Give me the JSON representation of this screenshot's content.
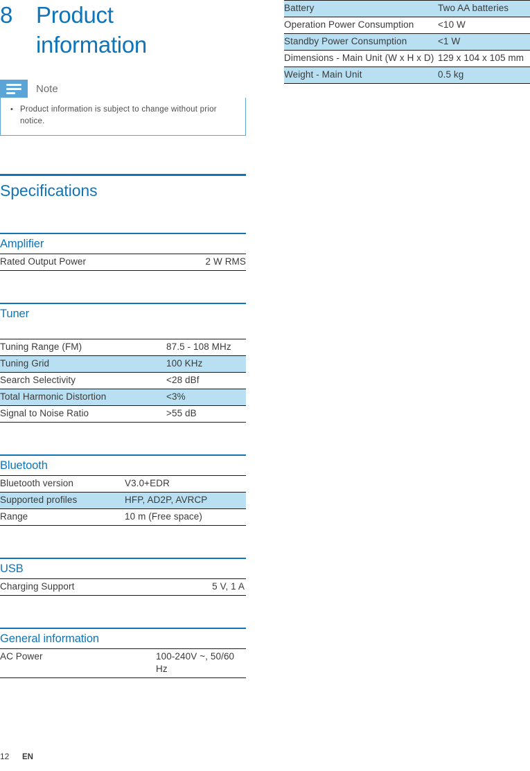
{
  "chapter": {
    "number": "8",
    "title": "Product information"
  },
  "note": {
    "icon": "note-lines-icon",
    "label": "Note",
    "items": [
      "Product information is subject to change without prior notice."
    ]
  },
  "specifications": {
    "heading": "Specifications",
    "sections": [
      {
        "title": "Amplifier",
        "style": "narrowval",
        "rows": [
          {
            "key": "Rated Output Power",
            "value": "2 W RMS",
            "highlight": false
          }
        ]
      },
      {
        "title": "Tuner",
        "style": "tuner",
        "rows": [
          {
            "key": "Tuning Range (FM)",
            "value": "87.5 - 108 MHz",
            "highlight": false
          },
          {
            "key": "Tuning Grid",
            "value": "100 KHz",
            "highlight": true
          },
          {
            "key": "Search Selectivity",
            "value": "<28 dBf",
            "highlight": false
          },
          {
            "key": "Total Harmonic Distortion",
            "value": "<3%",
            "highlight": true
          },
          {
            "key": "Signal to Noise Ratio",
            "value": ">55 dB",
            "highlight": false
          }
        ]
      },
      {
        "title": "Bluetooth",
        "style": "bt",
        "rows": [
          {
            "key": "Bluetooth version",
            "value": "V3.0+EDR",
            "highlight": false
          },
          {
            "key": "Supported profiles",
            "value": "HFP, AD2P, AVRCP",
            "highlight": true
          },
          {
            "key": "Range",
            "value": "10 m (Free space)",
            "highlight": false
          }
        ]
      },
      {
        "title": "USB",
        "style": "narrowval",
        "rows": [
          {
            "key": "Charging Support",
            "value": "5 V, 1 A",
            "highlight": false
          }
        ]
      },
      {
        "title": "General information",
        "style": "gen",
        "rows": [
          {
            "key": "AC Power",
            "value": "100-240V ~, 50/60 Hz",
            "highlight": false
          }
        ]
      }
    ]
  },
  "right_table": {
    "rows": [
      {
        "key": "Battery",
        "value": "Two AA batteries",
        "highlight": true
      },
      {
        "key": "Operation Power Consumption",
        "value": "<10 W",
        "highlight": false
      },
      {
        "key": "Standby Power Consumption",
        "value": "<1 W",
        "highlight": true
      },
      {
        "key": "Dimensions - Main Unit (W x H x D)",
        "value": "129 x 104 x 105 mm",
        "highlight": false
      },
      {
        "key": "Weight - Main Unit",
        "value": "0.5 kg",
        "highlight": true
      }
    ]
  },
  "footer": {
    "page": "12",
    "language": "EN"
  },
  "colors": {
    "brand_blue": "#0f74b8",
    "note_blue": "#5ba5d6",
    "row_highlight": "#b9e0f2",
    "rule_dark": "#1a1a1a"
  }
}
